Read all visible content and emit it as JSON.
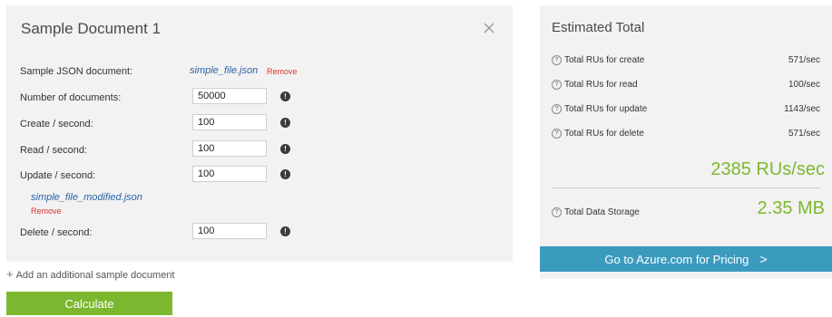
{
  "document": {
    "title": "Sample Document 1",
    "close_icon": "close-icon",
    "sample_json_label": "Sample JSON document:",
    "sample_json_file": "simple_file.json",
    "remove_label": "Remove",
    "rows": [
      {
        "label": "Number of documents:",
        "value": "50000"
      },
      {
        "label": "Create / second:",
        "value": "100"
      },
      {
        "label": "Read / second:",
        "value": "100"
      },
      {
        "label": "Update / second:",
        "value": "100"
      }
    ],
    "update_file": "simple_file_modified.json",
    "update_remove_label": "Remove",
    "delete_row": {
      "label": "Delete / second:",
      "value": "100"
    },
    "info_icon": "info-icon"
  },
  "add_document_label": "Add an additional sample document",
  "calculate_label": "Calculate",
  "estimate": {
    "title": "Estimated Total",
    "metrics": [
      {
        "label": "Total RUs for create",
        "value": "571/sec"
      },
      {
        "label": "Total RUs for read",
        "value": "100/sec"
      },
      {
        "label": "Total RUs for update",
        "value": "1143/sec"
      },
      {
        "label": "Total RUs for delete",
        "value": "571/sec"
      }
    ],
    "total_rus": "2385 RUs/sec",
    "storage_label": "Total Data Storage",
    "storage_value": "2.35 MB",
    "pricing_label": "Go to Azure.com for Pricing",
    "accent_color": "#7cb82f",
    "button_color": "#3b9bbf"
  }
}
